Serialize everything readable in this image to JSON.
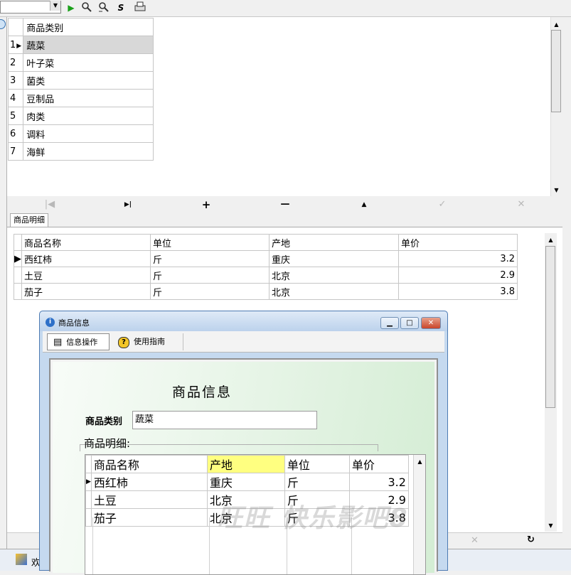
{
  "toolbar": {
    "combo_value": "",
    "icons": [
      "run-icon",
      "find-icon",
      "find-next-icon",
      "save-icon",
      "print-icon"
    ]
  },
  "category_grid": {
    "header": "商品类别",
    "rows": [
      {
        "num": "1",
        "name": "蔬菜"
      },
      {
        "num": "2",
        "name": "叶子菜"
      },
      {
        "num": "3",
        "name": "菌类"
      },
      {
        "num": "4",
        "name": "豆制品"
      },
      {
        "num": "5",
        "name": "肉类"
      },
      {
        "num": "6",
        "name": "调料"
      },
      {
        "num": "7",
        "name": "海鲜"
      }
    ],
    "selected_index": 0
  },
  "navigator": {
    "buttons": [
      {
        "name": "first",
        "glyph": "|◀"
      },
      {
        "name": "last",
        "glyph": "▶|"
      },
      {
        "name": "insert",
        "glyph": "+"
      },
      {
        "name": "delete",
        "glyph": "—"
      },
      {
        "name": "edit",
        "glyph": "▲"
      },
      {
        "name": "post",
        "glyph": "✓"
      },
      {
        "name": "cancel",
        "glyph": "✕"
      }
    ]
  },
  "detail_tab": {
    "label": "商品明细"
  },
  "detail_grid": {
    "headers": [
      "商品名称",
      "单位",
      "产地",
      "单价"
    ],
    "rows": [
      {
        "name": "西红柿",
        "unit": "斤",
        "origin": "重庆",
        "price": "3.2"
      },
      {
        "name": "土豆",
        "unit": "斤",
        "origin": "北京",
        "price": "2.9"
      },
      {
        "name": "茄子",
        "unit": "斤",
        "origin": "北京",
        "price": "3.8"
      }
    ]
  },
  "dialog": {
    "title": "商品信息",
    "tabs": [
      {
        "label": "信息操作",
        "icon": "info-panel-icon"
      },
      {
        "label": "使用指南",
        "icon": "help-icon"
      }
    ],
    "heading": "商品信息",
    "category_label": "商品类别",
    "category_value": "蔬菜",
    "detail_label": "商品明细:",
    "grid": {
      "headers": [
        "商品名称",
        "产地",
        "单位",
        "单价"
      ],
      "rows": [
        {
          "name": "西红柿",
          "origin": "重庆",
          "unit": "斤",
          "price": "3.2"
        },
        {
          "name": "土豆",
          "origin": "北京",
          "unit": "斤",
          "price": "2.9"
        },
        {
          "name": "茄子",
          "origin": "北京",
          "unit": "斤",
          "price": "3.8"
        }
      ]
    }
  },
  "taskbar": {
    "item_label": "欢"
  },
  "watermark": "旺旺 快乐影吧8",
  "colors": {
    "accent": "#4d7bb3",
    "header_highlight": "#ffff80",
    "selected_row": "#d8d8d8"
  }
}
